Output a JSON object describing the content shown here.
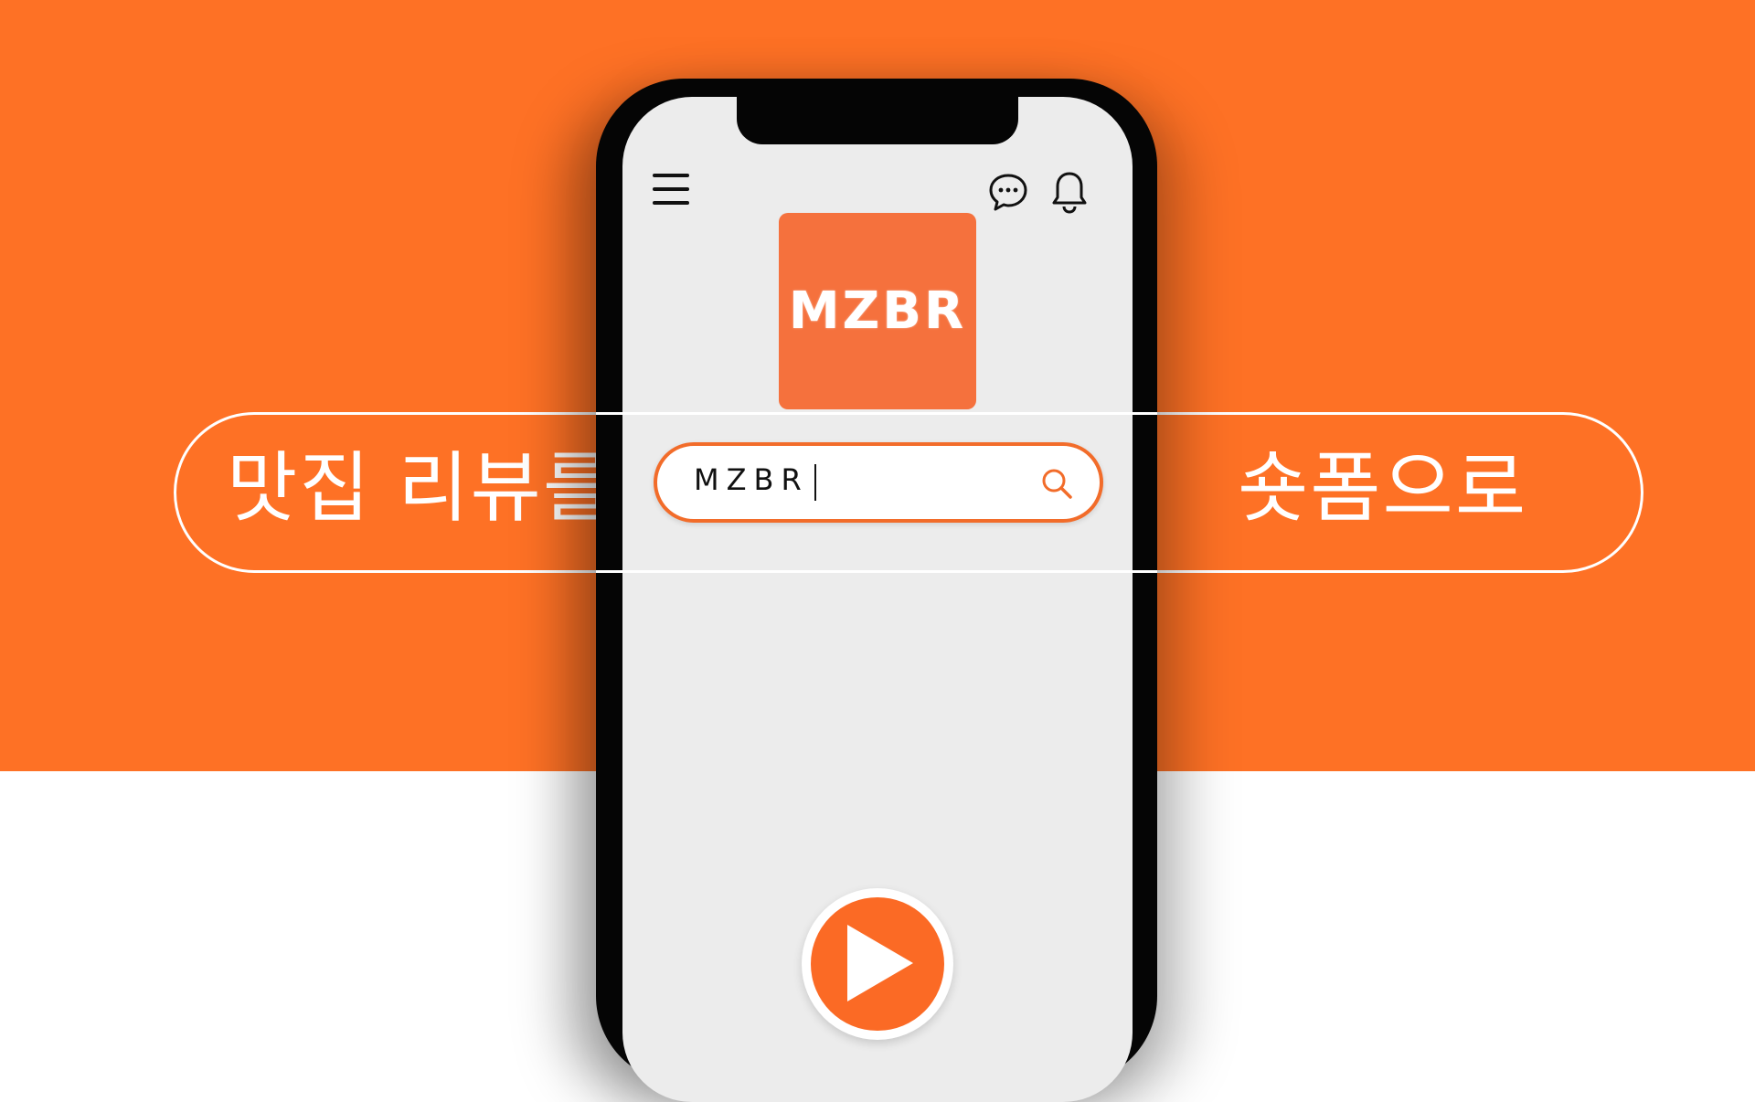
{
  "banner": {
    "left_text": "맛집 리뷰를",
    "right_text": "숏폼으로"
  },
  "app": {
    "logo_text": "MZBR",
    "search": {
      "value": "MZBR"
    },
    "icons": {
      "menu": "hamburger-menu-icon",
      "chat": "chat-bubble-icon",
      "notifications": "bell-icon",
      "search": "search-icon",
      "play": "play-icon"
    }
  },
  "colors": {
    "background": "#fe7125",
    "logo_tile": "#f5713d",
    "accent": "#f26c2a",
    "screen": "#ececec",
    "phone_frame": "#050505"
  }
}
